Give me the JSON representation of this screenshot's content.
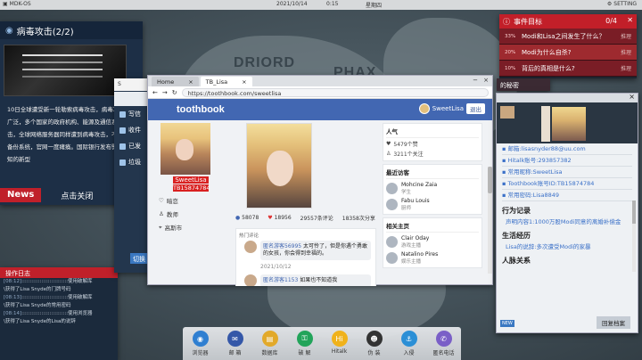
{
  "topbar": {
    "os": "MDK-OS",
    "date": "2021/10/14",
    "time": "0:15",
    "weekday": "星期四",
    "setting": "SETTING"
  },
  "map": {
    "labels": [
      "DRIORD",
      "PHAX"
    ]
  },
  "news": {
    "title": "病毒攻击(2/2)",
    "body": "10日全球遭受新一轮勒索病毒攻击，病毒攻击范围广泛，多个国家的政府机构、能源及通信系统等遭攻击，全球网络服务器同样遭到病毒攻击，不得不启用备份系统，官网一度瘫痪。国际银行发布警告说，未知的新型",
    "tag": "News",
    "close": "点击关闭"
  },
  "log": {
    "title": "操作日志",
    "rows": [
      {
        "time": "08:12",
        "sep": "::::::::::::::::::::::::::::",
        "action": "使用破解库",
        "detail": "\\获得了Lisa Snyde的门牌号码"
      },
      {
        "time": "08:13",
        "sep": "::::::::::::::::::::::::::::",
        "action": "使用破解库",
        "detail": "\\获得了Lisa Snyde的常用密码"
      },
      {
        "time": "08:14",
        "sep": "::::::::::::::::::::::::::::",
        "action": "使用浏览器",
        "detail": "\\获得了Lisa Snyde的Lisa的说辞"
      }
    ]
  },
  "midwin": {
    "title": "S",
    "items": [
      "写信",
      "收件",
      "已发",
      "垃圾"
    ],
    "button": "切换"
  },
  "browser": {
    "tabs": [
      "Home",
      "TB_Lisa"
    ],
    "url": "https://toothbook.com/sweetlisa"
  },
  "tb": {
    "logo": "toothbook",
    "user": "SweetLisa",
    "logout": "退出",
    "name": "SweetLisa",
    "id": "TB15874784",
    "info": [
      {
        "icon": "heart-icon",
        "text": "暗恋"
      },
      {
        "icon": "person-icon",
        "text": "教师"
      },
      {
        "icon": "pin-icon",
        "text": "高斯市"
      }
    ],
    "stats": {
      "likes": "58078",
      "hearts": "18956",
      "comments": "29557条评论",
      "shares": "18358次分享"
    },
    "comments_label": "热门评论",
    "comment": {
      "name": "匿名游客56995",
      "text": "太可怜了，但是你遇个勇敢的女孩，你会得到幸福的。",
      "date": "2021/10/12"
    },
    "comment2": {
      "name": "匿名游客1153",
      "text": "如果也不知道我"
    },
    "popular": {
      "title": "人气",
      "likes": "5479个赞",
      "follow": "3211个关注"
    },
    "visitors": {
      "title": "最近访客",
      "items": [
        {
          "name": "Mohcine Zaia",
          "role": "学生"
        },
        {
          "name": "Fabu Louis",
          "role": "厨师"
        }
      ]
    },
    "related": {
      "title": "相关主页",
      "items": [
        {
          "name": "Clair Oday",
          "role": "游戏主播"
        },
        {
          "name": "Natalino Pires",
          "role": "娱乐主播"
        }
      ]
    }
  },
  "target": {
    "title": "事件目标",
    "count": "0/4",
    "rows": [
      {
        "pct": "33%",
        "text": "Modi和Lisa之间发生了什么？",
        "hint": "推理"
      },
      {
        "pct": "20%",
        "text": "Modi为什么自杀?",
        "hint": "推理"
      },
      {
        "pct": "10%",
        "text": "背后的真相是什么?",
        "hint": "推理"
      }
    ]
  },
  "secret": "的秘密",
  "profile": {
    "info": [
      "邮箱:lisasnyder88@uu.com",
      "Hitalk账号:293857382",
      "常用昵称:SweetLisa",
      "Toothbook账号ID:TB15874784",
      "常用密码:Lisa8849"
    ],
    "life_title": "行为记录",
    "life": "声明内容1:1000万股Modi同意的离婚补偿金",
    "exp_title": "生活经历",
    "exp": "Lisa的说辞:多次遭受Modi的家暴",
    "rel_title": "人脉关系",
    "back": "回复档案",
    "small": "NEW"
  },
  "dock": [
    {
      "label": "浏览器",
      "icon": "browser-icon",
      "color": "#2f7fd1",
      "glyph": "◉"
    },
    {
      "label": "邮 箱",
      "icon": "mail-icon",
      "color": "#3457a8",
      "glyph": "✉"
    },
    {
      "label": "数据库",
      "icon": "database-icon",
      "color": "#e2a92a",
      "glyph": "▤"
    },
    {
      "label": "破 解",
      "icon": "crack-icon",
      "color": "#22a45a",
      "glyph": "⚿"
    },
    {
      "label": "Hitalk",
      "icon": "hitalk-icon",
      "color": "#f0b21b",
      "glyph": "Hi"
    },
    {
      "label": "伪 装",
      "icon": "disguise-icon",
      "color": "#333",
      "glyph": "☻"
    },
    {
      "label": "入侵",
      "icon": "intrude-icon",
      "color": "#2b8fd6",
      "glyph": "⚓"
    },
    {
      "label": "匿名电话",
      "icon": "phone-icon",
      "color": "#7a5fc7",
      "glyph": "✆"
    }
  ]
}
